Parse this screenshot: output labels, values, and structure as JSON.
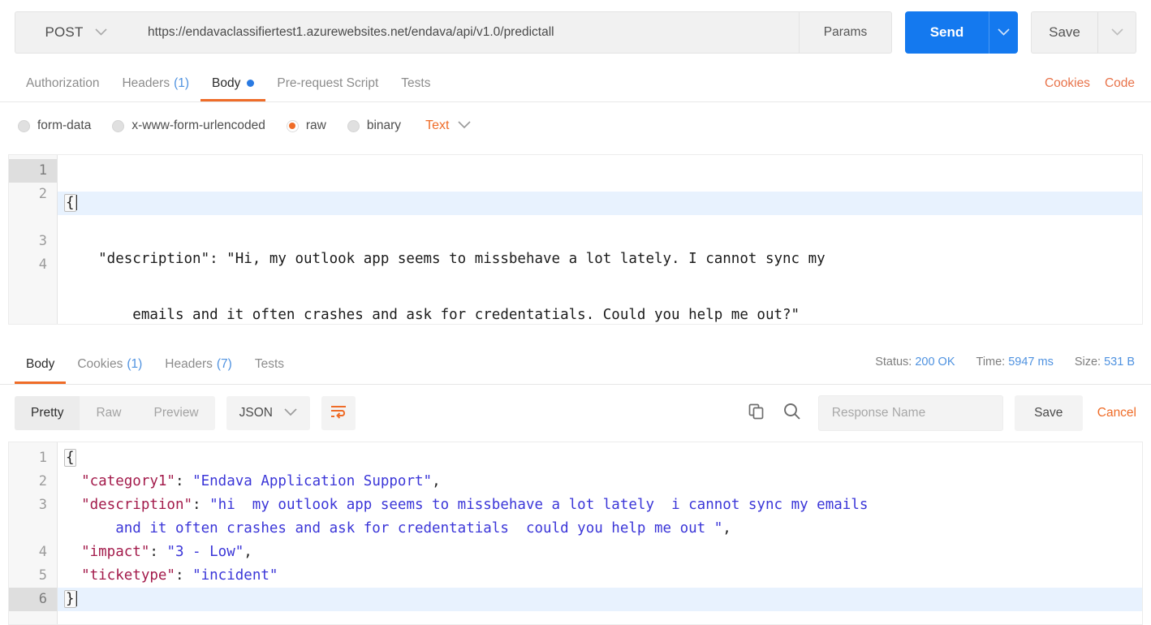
{
  "request": {
    "method": "POST",
    "url": "https://endavaclassifiertest1.azurewebsites.net/endava/api/v1.0/predictall",
    "params_label": "Params",
    "send_label": "Send",
    "save_label": "Save",
    "tabs": [
      {
        "label": "Authorization",
        "count": "",
        "active": false,
        "dot": false
      },
      {
        "label": "Headers",
        "count": "(1)",
        "active": false,
        "dot": false
      },
      {
        "label": "Body",
        "count": "",
        "active": true,
        "dot": true
      },
      {
        "label": "Pre-request Script",
        "count": "",
        "active": false,
        "dot": false
      },
      {
        "label": "Tests",
        "count": "",
        "active": false,
        "dot": false
      }
    ],
    "tabs_right": [
      {
        "label": "Cookies"
      },
      {
        "label": "Code"
      }
    ],
    "body_types": [
      {
        "label": "form-data",
        "selected": false
      },
      {
        "label": "x-www-form-urlencoded",
        "selected": false
      },
      {
        "label": "raw",
        "selected": true
      },
      {
        "label": "binary",
        "selected": false
      }
    ],
    "raw_format": "Text",
    "editor": {
      "line_numbers": [
        "1",
        "2",
        "3",
        "4"
      ],
      "lines": [
        "{",
        "    \"description\": \"Hi, my outlook app seems to missbehave a lot lately. I cannot sync my",
        "        emails and it often crashes and ask for credentatials. Could you help me out?\"",
        "}",
        ""
      ]
    }
  },
  "response": {
    "tabs": [
      {
        "label": "Body",
        "count": "",
        "active": true
      },
      {
        "label": "Cookies",
        "count": "(1)",
        "active": false
      },
      {
        "label": "Headers",
        "count": "(7)",
        "active": false
      },
      {
        "label": "Tests",
        "count": "",
        "active": false
      }
    ],
    "status_label": "Status:",
    "status_value": "200 OK",
    "time_label": "Time:",
    "time_value": "5947 ms",
    "size_label": "Size:",
    "size_value": "531 B",
    "view_modes": [
      {
        "label": "Pretty",
        "active": true
      },
      {
        "label": "Raw",
        "active": false
      },
      {
        "label": "Preview",
        "active": false
      }
    ],
    "language": "JSON",
    "response_name_placeholder": "Response Name",
    "response_name_value": "",
    "save_label": "Save",
    "cancel_label": "Cancel",
    "body": {
      "line_numbers": [
        "1",
        "2",
        "3",
        "4",
        "5",
        "6"
      ],
      "json": {
        "category1": "Endava Application Support",
        "description": "hi  my outlook app seems to missbehave a lot lately  i cannot sync my emails and it often crashes and ask for credentatials  could you help me out ",
        "impact": "3 - Low",
        "ticketype": "incident"
      },
      "rendered_lines": [
        {
          "num": "1",
          "parts": [
            {
              "t": "{",
              "c": "p"
            }
          ]
        },
        {
          "num": "2",
          "parts": [
            {
              "t": "  ",
              "c": "p"
            },
            {
              "t": "\"category1\"",
              "c": "k"
            },
            {
              "t": ": ",
              "c": "p"
            },
            {
              "t": "\"Endava Application Support\"",
              "c": "s"
            },
            {
              "t": ",",
              "c": "p"
            }
          ]
        },
        {
          "num": "3",
          "parts": [
            {
              "t": "  ",
              "c": "p"
            },
            {
              "t": "\"description\"",
              "c": "k"
            },
            {
              "t": ": ",
              "c": "p"
            },
            {
              "t": "\"hi  my outlook app seems to missbehave a lot lately  i cannot sync my emails",
              "c": "s"
            }
          ]
        },
        {
          "num": "",
          "parts": [
            {
              "t": "      ",
              "c": "p"
            },
            {
              "t": "and it often crashes and ask for credentatials  could you help me out \"",
              "c": "s"
            },
            {
              "t": ",",
              "c": "p"
            }
          ]
        },
        {
          "num": "4",
          "parts": [
            {
              "t": "  ",
              "c": "p"
            },
            {
              "t": "\"impact\"",
              "c": "k"
            },
            {
              "t": ": ",
              "c": "p"
            },
            {
              "t": "\"3 - Low\"",
              "c": "s"
            },
            {
              "t": ",",
              "c": "p"
            }
          ]
        },
        {
          "num": "5",
          "parts": [
            {
              "t": "  ",
              "c": "p"
            },
            {
              "t": "\"ticketype\"",
              "c": "k"
            },
            {
              "t": ": ",
              "c": "p"
            },
            {
              "t": "\"incident\"",
              "c": "s"
            }
          ]
        },
        {
          "num": "6",
          "parts": [
            {
              "t": "}",
              "c": "p"
            }
          ]
        }
      ]
    }
  },
  "colors": {
    "accent_orange": "#ef6c28",
    "send_blue": "#1479ef",
    "link_blue": "#4f92e0",
    "json_key": "#a31b4b",
    "json_string": "#3b36d8",
    "active_line": "#e8f2fe"
  },
  "icons": {
    "method_caret": "chevron-down-icon",
    "send_caret": "chevron-down-icon",
    "save_caret": "chevron-down-icon",
    "format_caret": "chevron-down-icon",
    "lang_caret": "chevron-down-icon",
    "wrap": "word-wrap-icon",
    "copy": "copy-icon",
    "search": "search-icon"
  }
}
